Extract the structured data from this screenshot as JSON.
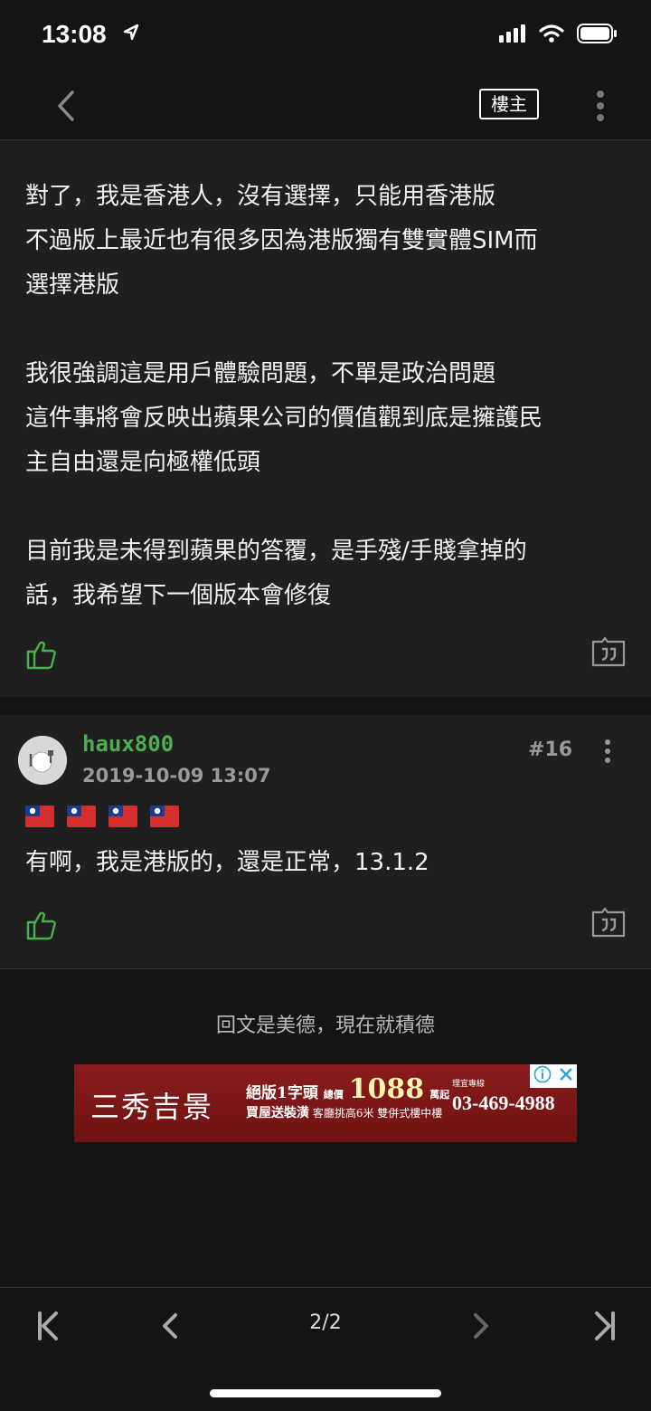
{
  "status": {
    "time": "13:08"
  },
  "nav": {
    "op_label": "樓主"
  },
  "post1": {
    "lines": [
      "對了，我是香港人，沒有選擇，只能用香港版",
      "不過版上最近也有很多因為港版獨有雙實體SIM而",
      "選擇港版",
      "",
      "我很強調這是用戶體驗問題，不單是政治問題",
      "這件事將會反映出蘋果公司的價值觀到底是擁護民",
      "主自由還是向極權低頭",
      "",
      "目前我是未得到蘋果的答覆，是手殘/手賤拿掉的",
      "話，我希望下一個版本會修復"
    ]
  },
  "post2": {
    "username": "haux800",
    "date": "2019-10-09 13:07",
    "floor": "#16",
    "flag_count": 4,
    "text": "有啊，我是港版的，還是正常，13.1.2"
  },
  "footer": {
    "encourage": "回文是美德，現在就積德"
  },
  "ad": {
    "brand": "三秀吉景",
    "tagline1": "絕版1字頭",
    "price_label": "總價",
    "price": "1088",
    "price_unit": "萬起",
    "tagline2": "買屋送裝潢",
    "sub1": "客廳挑高6米",
    "sub2": "雙併式樓中樓",
    "phone": "03-469-4988",
    "top_small": "理宜專線"
  },
  "pagination": {
    "current": "2/2"
  },
  "colors": {
    "accent_green": "#4caf50",
    "background": "#141414",
    "card": "#1f1f1f"
  }
}
